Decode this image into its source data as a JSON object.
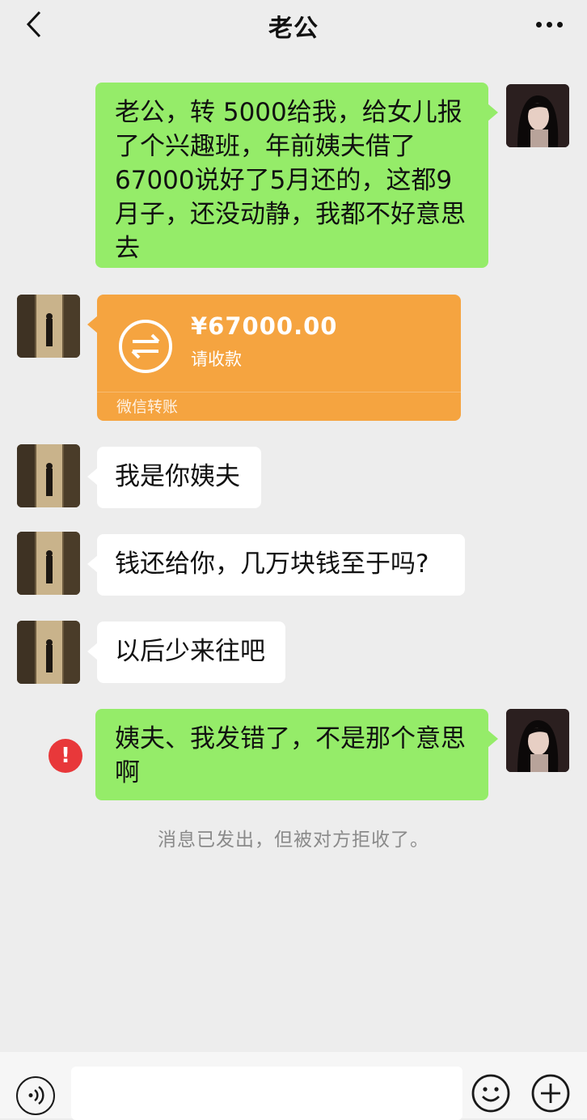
{
  "header": {
    "title": "老公"
  },
  "messages": [
    {
      "side": "right",
      "text": "老公，转 5000给我，给女儿报了个兴趣班，年前姨夫借了67000说好了5月还的，这都9月子，还没动静，我都不好意思去"
    },
    {
      "side": "left",
      "type": "transfer",
      "amount": "¥67000.00",
      "status": "请收款",
      "label": "微信转账"
    },
    {
      "side": "left",
      "text": "我是你姨夫"
    },
    {
      "side": "left",
      "text": "钱还给你，几万块钱至于吗?"
    },
    {
      "side": "left",
      "text": "以后少来往吧"
    },
    {
      "side": "right",
      "text": "姨夫、我发错了，不是那个意思啊",
      "error": "!"
    }
  ],
  "system_note": "消息已发出，但被对方拒收了。",
  "colors": {
    "background": "#ededed",
    "green_bubble": "#95ec69",
    "white_bubble": "#ffffff",
    "transfer": "#f5a440",
    "error": "#e8383a"
  }
}
